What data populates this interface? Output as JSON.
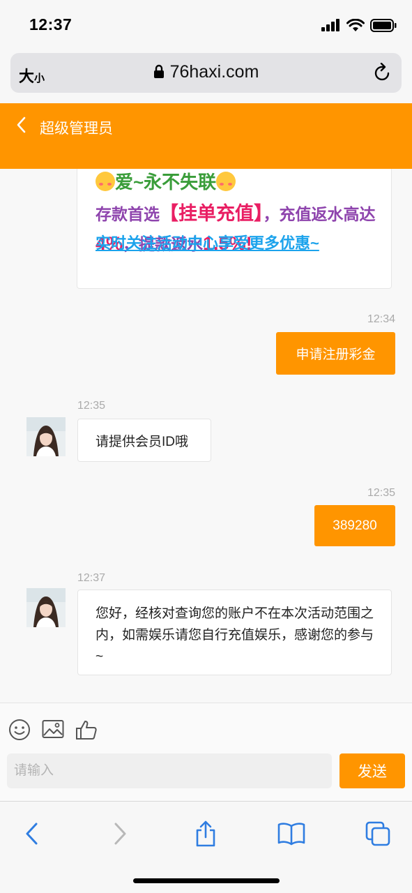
{
  "status_bar": {
    "time": "12:37"
  },
  "browser": {
    "text_size": {
      "big": "大",
      "small": "小"
    },
    "url": "76haxi.com"
  },
  "header": {
    "title": "超级管理员"
  },
  "promo": {
    "line1": "爱~永不失联",
    "line2_prefix": "存款首选",
    "line2_highlight": "【挂单充值】",
    "line2_mid": "，充值返水高达",
    "line2_pct1": "4%",
    "line2_mid2": "，提款返水",
    "line2_pct2": "1.5%!",
    "link": "实时关注活动中心享受更多优惠~"
  },
  "messages": [
    {
      "from": "me",
      "time": "12:34",
      "text": "申请注册彩金"
    },
    {
      "from": "agent",
      "time": "12:35",
      "text": "请提供会员ID哦"
    },
    {
      "from": "me",
      "time": "12:35",
      "text": "389280"
    },
    {
      "from": "agent",
      "time": "12:37",
      "text": "您好，经核对查询您的账户不在本次活动范围之内，如需娱乐请您自行充值娱乐，感谢您的参与~"
    }
  ],
  "composer": {
    "placeholder": "请输入",
    "send_label": "发送",
    "tools": [
      "emoji-icon",
      "image-icon",
      "thumbs-up-icon"
    ]
  },
  "toolbar": {
    "buttons": [
      "back-icon",
      "forward-icon",
      "share-icon",
      "bookmarks-icon",
      "tabs-icon"
    ]
  },
  "colors": {
    "accent": "#ff9500",
    "link": "#1ca3ec",
    "toolbar_icon": "#2f7de1"
  }
}
